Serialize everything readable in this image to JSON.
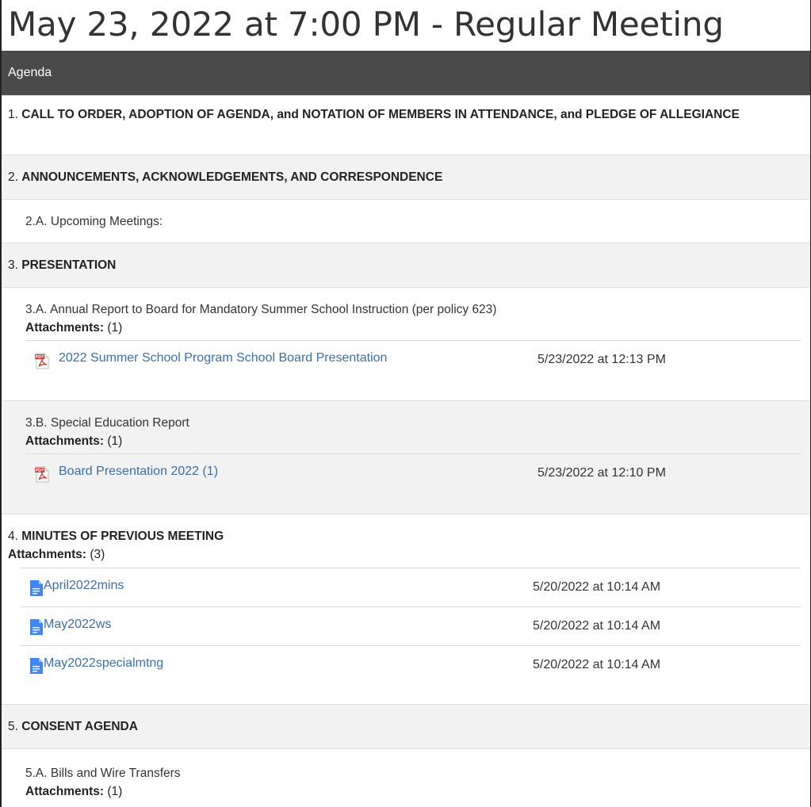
{
  "page_title": "May 23, 2022 at 7:00 PM - Regular Meeting",
  "agenda_header": "Agenda",
  "items": {
    "i1": {
      "num": "1.",
      "title": "CALL TO ORDER, ADOPTION OF AGENDA, and NOTATION OF MEMBERS IN ATTENDANCE, and PLEDGE OF ALLEGIANCE"
    },
    "i2": {
      "num": "2.",
      "title": "ANNOUNCEMENTS, ACKNOWLEDGEMENTS, AND CORRESPONDENCE"
    },
    "i2a": {
      "title": "2.A. Upcoming Meetings:"
    },
    "i3": {
      "num": "3.",
      "title": "PRESENTATION"
    },
    "i3a": {
      "title": "3.A. Annual Report to Board for Mandatory Summer School Instruction (per policy 623)",
      "attachments_label": "Attachments:",
      "attachments_count": "(1)",
      "files": [
        {
          "name": "2022 Summer School Program School Board Presentation",
          "date": "5/23/2022 at 12:13 PM",
          "icon": "pdf-icon"
        }
      ]
    },
    "i3b": {
      "title": "3.B. Special Education Report",
      "attachments_label": "Attachments:",
      "attachments_count": "(1)",
      "files": [
        {
          "name": "Board Presentation 2022 (1)",
          "date": "5/23/2022 at 12:10 PM",
          "icon": "pdf-icon"
        }
      ]
    },
    "i4": {
      "num": "4.",
      "title": "MINUTES OF PREVIOUS MEETING",
      "attachments_label": "Attachments:",
      "attachments_count": "(3)",
      "files": [
        {
          "name": "April2022mins",
          "date": "5/20/2022 at 10:14 AM",
          "icon": "google-doc-icon"
        },
        {
          "name": "May2022ws",
          "date": "5/20/2022 at 10:14 AM",
          "icon": "google-doc-icon"
        },
        {
          "name": "May2022specialmtng",
          "date": "5/20/2022 at 10:14 AM",
          "icon": "google-doc-icon"
        }
      ]
    },
    "i5": {
      "num": "5.",
      "title": "CONSENT AGENDA"
    },
    "i5a": {
      "title": "5.A. Bills and Wire Transfers",
      "attachments_label": "Attachments:",
      "attachments_count": "(1)"
    }
  },
  "colors": {
    "header_bar": "#4a4a4a",
    "link": "#3b6fa8",
    "row_grey": "#f2f2f2",
    "pdf_red": "#d0312d",
    "doc_blue": "#4285f4"
  }
}
